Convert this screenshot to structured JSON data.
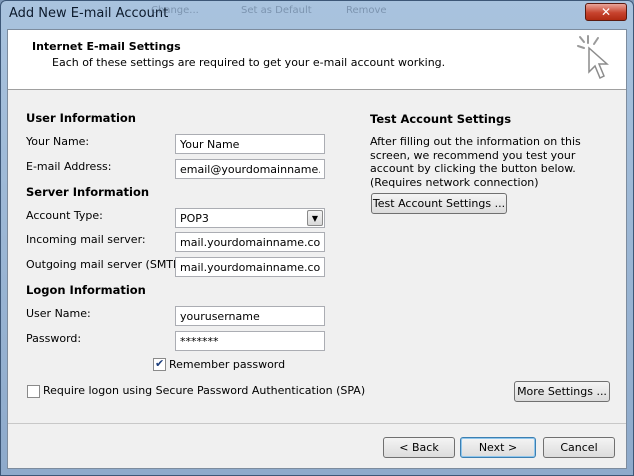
{
  "window": {
    "title": "Add New E-mail Account",
    "close_glyph": "✕",
    "ghost_tabs": [
      "Change...",
      "Set as Default",
      "Remove"
    ]
  },
  "header": {
    "title": "Internet E-mail Settings",
    "subtitle": "Each of these settings are required to get your e-mail account working."
  },
  "user_info": {
    "heading": "User Information",
    "name_label": "Your Name:",
    "name_value": "Your Name",
    "email_label": "E-mail Address:",
    "email_value": "email@yourdomainname.com"
  },
  "server_info": {
    "heading": "Server Information",
    "account_type_label": "Account Type:",
    "account_type_value": "POP3",
    "incoming_label": "Incoming mail server:",
    "incoming_value": "mail.yourdomainname.com",
    "outgoing_label": "Outgoing mail server (SMTP):",
    "outgoing_value": "mail.yourdomainname.com"
  },
  "logon_info": {
    "heading": "Logon Information",
    "username_label": "User Name:",
    "username_value": "yourusername",
    "password_label": "Password:",
    "password_value": "*******",
    "remember_label": "Remember password",
    "remember_checked": true,
    "spa_label": "Require logon using Secure Password Authentication (SPA)",
    "spa_checked": false
  },
  "test_settings": {
    "heading": "Test Account Settings",
    "description": "After filling out the information on this screen, we recommend you test your account by clicking the button below. (Requires network connection)",
    "button_label": "Test Account Settings ..."
  },
  "buttons": {
    "more_settings": "More Settings ...",
    "back": "< Back",
    "next": "Next >",
    "cancel": "Cancel"
  },
  "icons": {
    "header_icon": "cursor-click-icon",
    "dropdown_icon": "chevron-down-icon"
  },
  "colors": {
    "titlebar": "#a9c3de",
    "client_bg": "#f0f0f0",
    "close_button": "#c7432e"
  }
}
